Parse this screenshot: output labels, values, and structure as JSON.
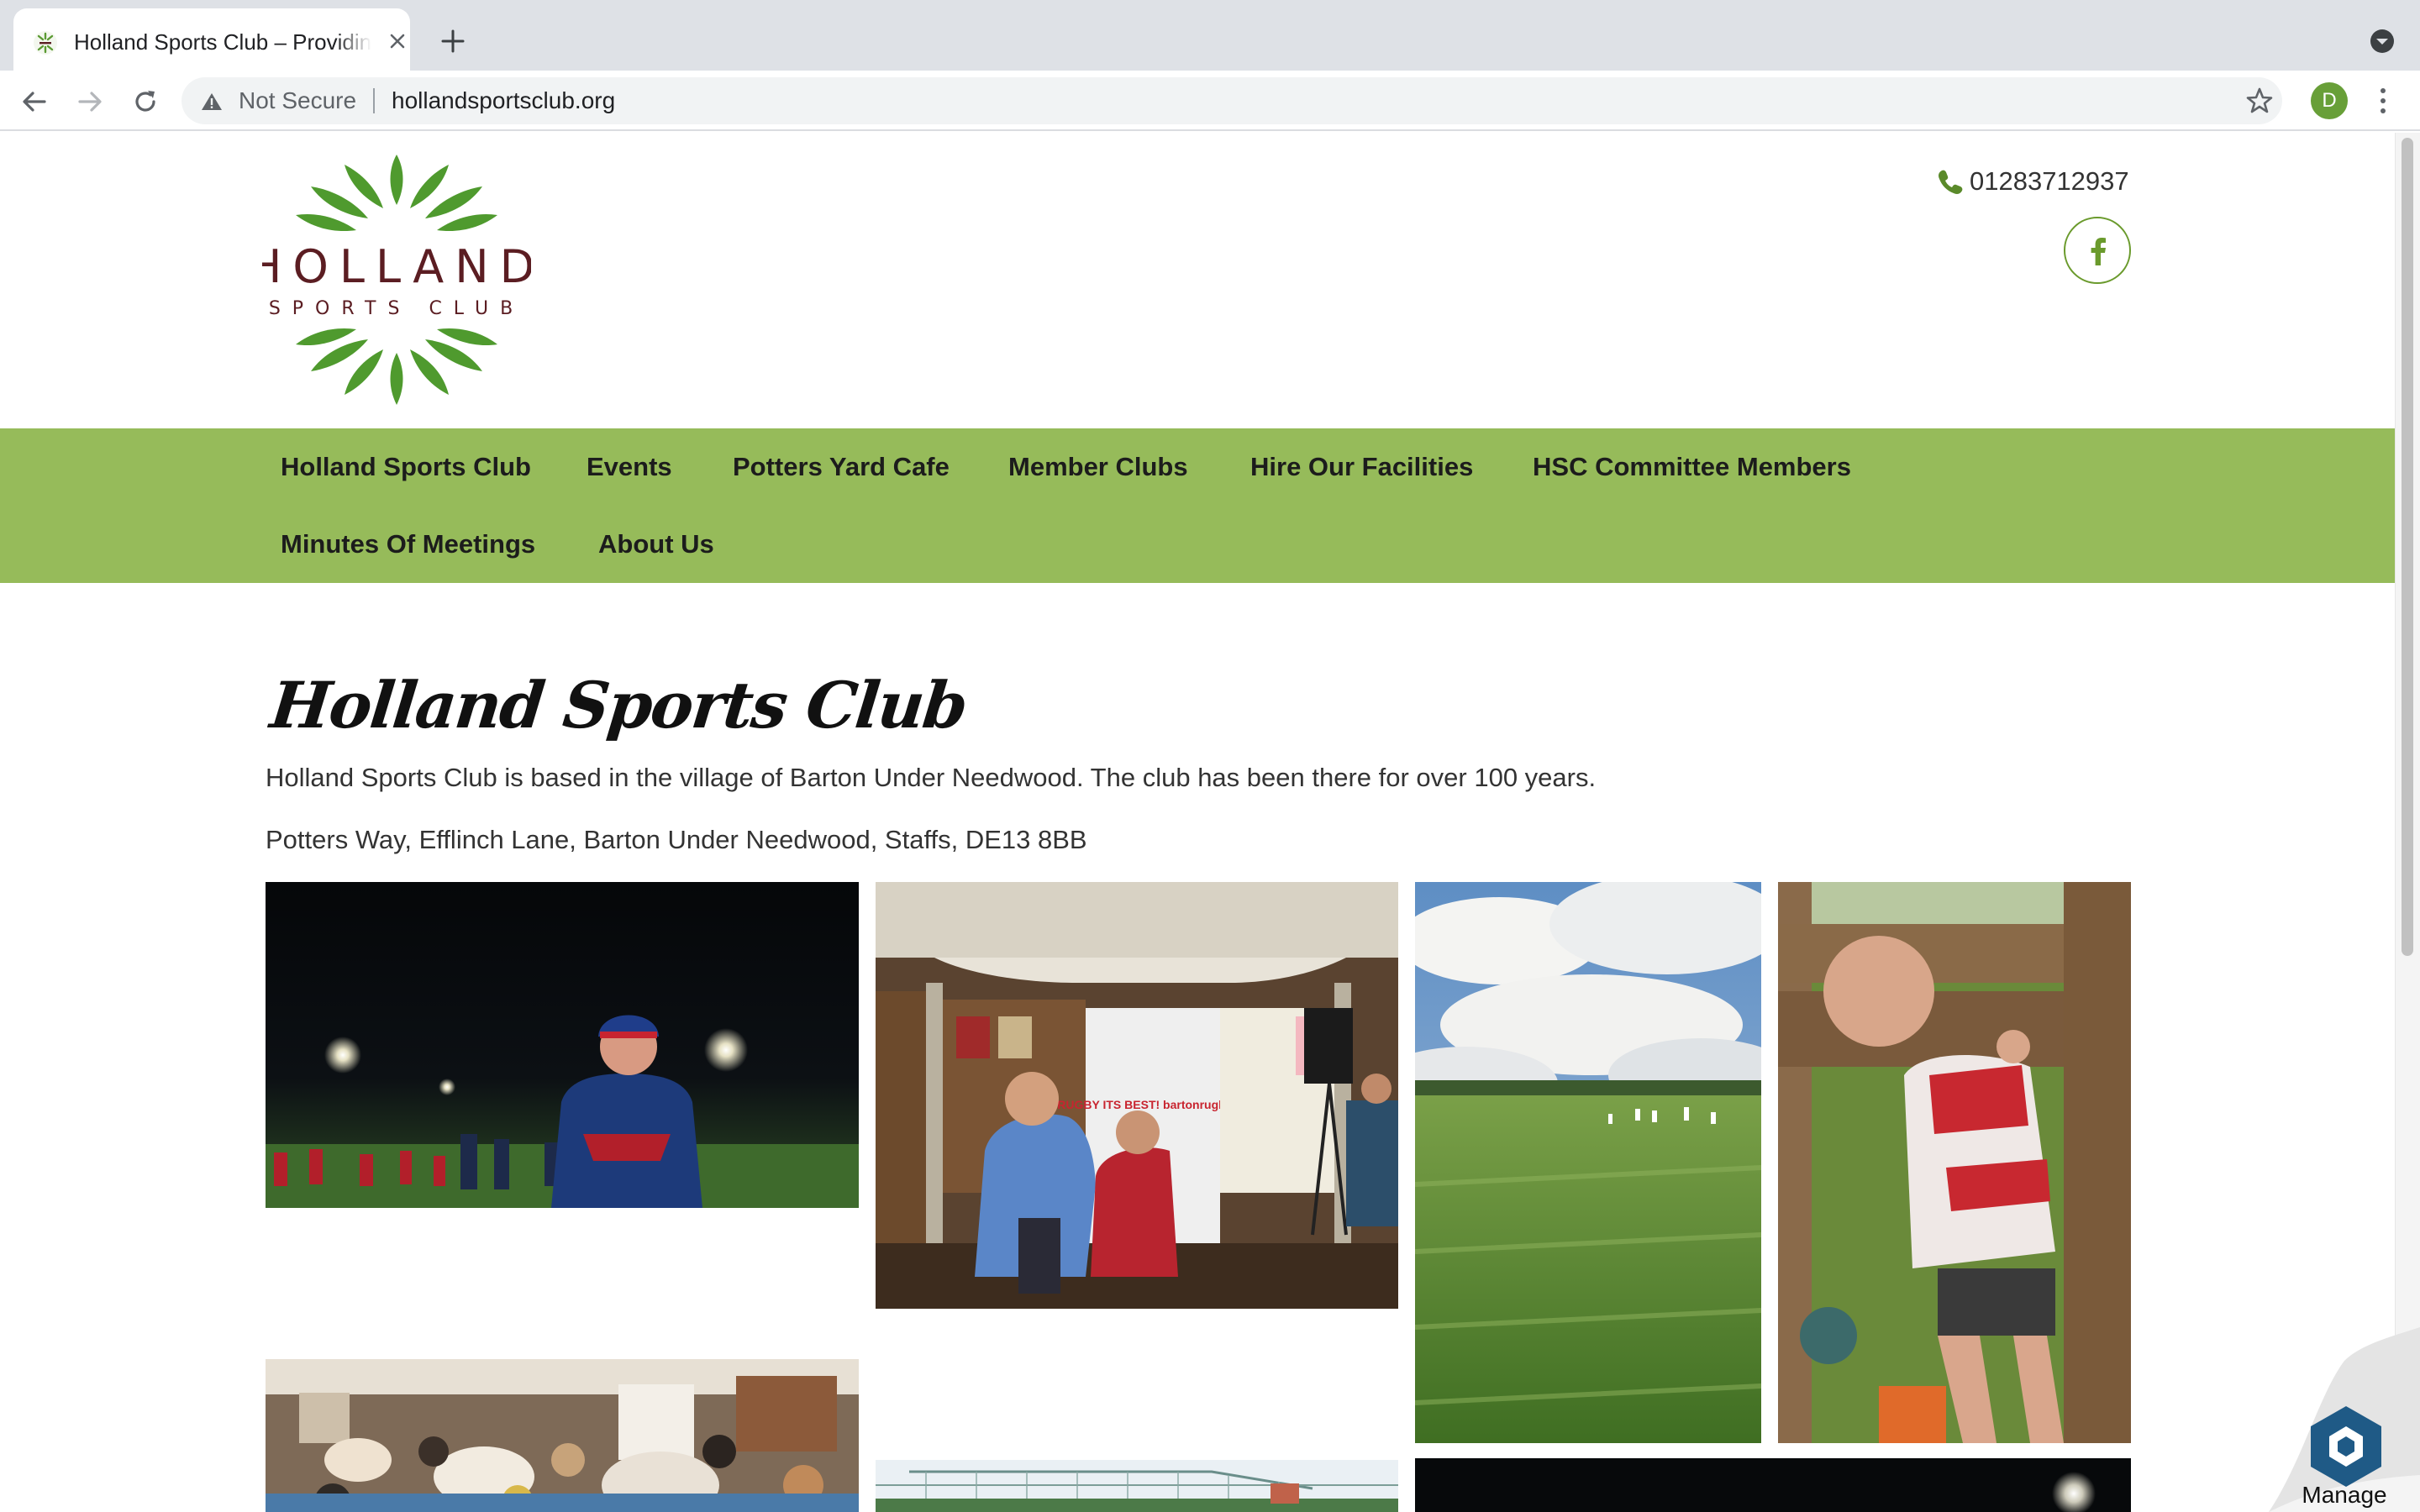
{
  "browser": {
    "tab_title": "Holland Sports Club – Providing",
    "security_label": "Not Secure",
    "url": "hollandsportsclub.org",
    "profile_initial": "D"
  },
  "header": {
    "logo_main": "HOLLAND",
    "logo_sub": "SPORTS CLUB",
    "phone": "01283712937",
    "facebook_icon": "facebook-icon"
  },
  "nav": {
    "items": [
      "Holland Sports Club",
      "Events",
      "Potters Yard Cafe",
      "Member Clubs",
      "Hire Our Facilities",
      "HSC Committee Members",
      "Minutes Of Meetings",
      "About Us"
    ]
  },
  "content": {
    "heading": "Holland Sports Club",
    "intro": "Holland Sports Club is based in the village of Barton Under Needwood. The club has been there for over 100 years.",
    "address": "Potters Way, Efflinch Lane, Barton Under Needwood, Staffs, DE13 8BB"
  },
  "gallery": {
    "photos": [
      {
        "name": "night-training-photo",
        "banner": ""
      },
      {
        "name": "rugby-evening-photo",
        "banner": "RUGBY ITS BEST! bartonrugby.co"
      },
      {
        "name": "cricket-field-photo",
        "banner": ""
      },
      {
        "name": "man-in-stocks-photo",
        "banner": ""
      },
      {
        "name": "ladies-dinner-photo",
        "banner": ""
      },
      {
        "name": "cricket-nets-photo",
        "banner": ""
      },
      {
        "name": "floodlit-pitch-photo",
        "banner": ""
      }
    ]
  },
  "widget": {
    "manage_label": "Manage"
  },
  "colors": {
    "nav_green": "#96bb5a",
    "logo_green": "#4f9a2e",
    "logo_maroon": "#5b1d22"
  }
}
